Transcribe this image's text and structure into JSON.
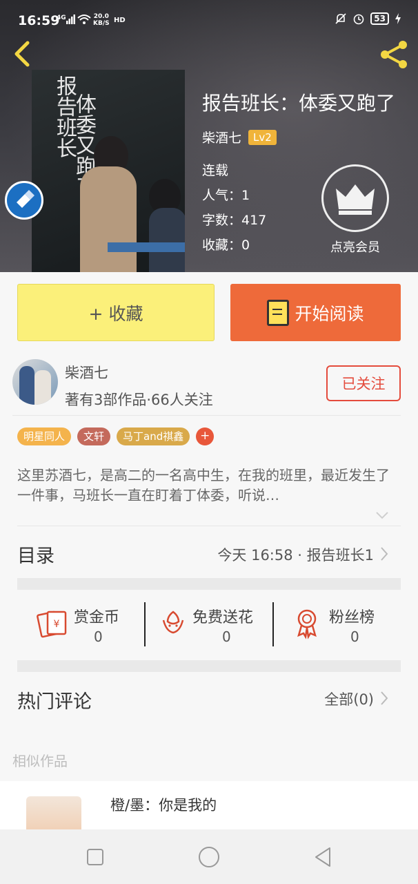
{
  "status_bar": {
    "time": "16:59",
    "network": "4G",
    "speed_value": "20.0",
    "speed_unit": "KB/S",
    "hd": "HD",
    "battery": "53"
  },
  "colors": {
    "accent_orange": "#ee6a3a",
    "collect_yellow": "#fbf07a",
    "follow_red": "#e44b3c",
    "lv_gold": "#f0b43a"
  },
  "book": {
    "title": "报告班长：体委又跑了",
    "author": "柴酒七",
    "level": "Lv2",
    "status": "连载",
    "popularity": "人气：1",
    "word_count": "字数：417",
    "favorites": "收藏：0",
    "vip_label": "点亮会员",
    "cover_line1": "报告",
    "cover_line2": "班长",
    "cover_line3": "体委",
    "cover_line4": "又跑了"
  },
  "actions": {
    "collect_label": "+ 收藏",
    "read_label": "开始阅读"
  },
  "author_card": {
    "name": "柴酒七",
    "meta": "著有3部作品·66人关注",
    "follow_label": "已关注"
  },
  "tags": [
    {
      "label": "明星同人",
      "color": "#f4b34c"
    },
    {
      "label": "文轩",
      "color": "#c46a5c"
    },
    {
      "label": "马丁and祺鑫",
      "color": "#d9a94a"
    }
  ],
  "description": "这里苏酒七，是高二的一名高中生，在我的班里，最近发生了一件事，马班长一直在盯着丁体委，听说…",
  "toc": {
    "title": "目录",
    "latest": "今天 16:58 · 报告班长1"
  },
  "rewards": [
    {
      "label": "赏金币",
      "value": "0",
      "icon": "red-envelope-icon"
    },
    {
      "label": "免费送花",
      "value": "0",
      "icon": "flower-icon"
    },
    {
      "label": "粉丝榜",
      "value": "0",
      "icon": "award-ribbon-icon"
    }
  ],
  "comments": {
    "title": "热门评论",
    "all_label": "全部(0)"
  },
  "similar": {
    "label": "相似作品",
    "items": [
      {
        "title": "橙/墨：你是我的"
      }
    ]
  },
  "nav": {
    "icons": [
      "recents-square-icon",
      "home-circle-icon",
      "back-triangle-icon"
    ]
  }
}
